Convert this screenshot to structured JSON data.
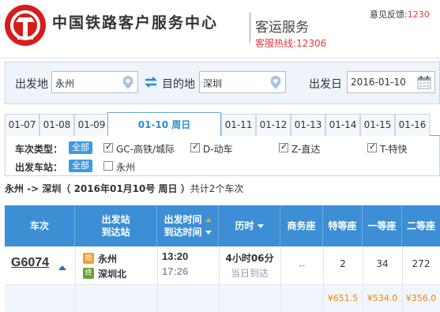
{
  "header": {
    "brand": "中国铁路客户服务中心",
    "service": "客运服务",
    "hotline": "客服热线:12306",
    "feedback_label": "意见反馈:",
    "feedback_phone": "1230"
  },
  "search": {
    "from_label": "出发地",
    "from_value": "永州",
    "to_label": "目的地",
    "to_value": "深圳",
    "date_label": "出发日",
    "date_value": "2016-01-10"
  },
  "tabs": [
    "01-07",
    "01-08",
    "01-09",
    "01-10 周日",
    "01-11",
    "01-12",
    "01-13",
    "01-14",
    "01-15",
    "01-16"
  ],
  "active_tab": 3,
  "filters": {
    "type_label": "车次类型：",
    "all_label": "全部",
    "types": [
      "GC-高铁/城际",
      "D-动车",
      "Z-直达",
      "T-特快"
    ],
    "station_label": "出发车站：",
    "station_all": "全部",
    "stations": [
      "永州"
    ]
  },
  "summary": {
    "route": "永州 -> 深圳",
    "date": "（ 2016年01月10号  周日 ）",
    "count": "共计2个车次"
  },
  "table": {
    "headers": {
      "train": "车次",
      "station_from": "出发站",
      "station_to": "到达站",
      "time_from": "出发时间",
      "time_to": "到达时间",
      "duration": "历时",
      "business": "商务座",
      "special": "特等座",
      "first": "一等座",
      "second": "二等座"
    },
    "rows": [
      {
        "train": "G6074",
        "from_badge": "始",
        "from_station": "永州",
        "to_badge": "终",
        "to_station": "深圳北",
        "depart": "13:20",
        "arrive": "17:26",
        "duration": "4小时06分",
        "arrival_day": "当日到达",
        "business": "--",
        "special": "2",
        "first": "34",
        "second": "272",
        "special_price": "¥651.5",
        "first_price": "¥534.0",
        "second_price": "¥356.0"
      }
    ]
  },
  "colors": {
    "accent": "#3c8ed5",
    "hotline": "#e4393c",
    "price": "#f08300"
  }
}
